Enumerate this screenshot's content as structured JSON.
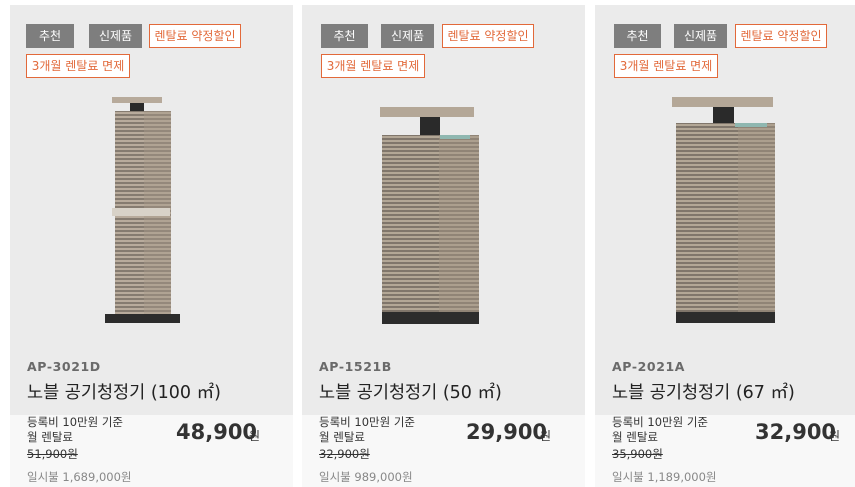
{
  "products": [
    {
      "badges": [
        "추천",
        "신제품",
        "렌탈료 약정할인",
        "3개월 렌탈료 면제"
      ],
      "model": "AP-3021D",
      "name": "노블 공기청정기 (100 ㎡)",
      "registration_line1": "등록비 10만원 기준",
      "registration_line2": "월 렌탈료",
      "original_price": "51,900원",
      "price": "48,900",
      "price_unit": "원",
      "lump_sum": "일시불 1,689,000원"
    },
    {
      "badges": [
        "추천",
        "신제품",
        "렌탈료 약정할인",
        "3개월 렌탈료 면제"
      ],
      "model": "AP-1521B",
      "name": "노블 공기청정기 (50 ㎡)",
      "registration_line1": "등록비 10만원 기준",
      "registration_line2": "월 렌탈료",
      "original_price": "32,900원",
      "price": "29,900",
      "price_unit": "원",
      "lump_sum": "일시불 989,000원"
    },
    {
      "badges": [
        "추천",
        "신제품",
        "렌탈료 약정할인",
        "3개월 렌탈료 면제"
      ],
      "model": "AP-2021A",
      "name": "노블 공기청정기 (67 ㎡)",
      "registration_line1": "등록비 10만원 기준",
      "registration_line2": "월 렌탈료",
      "original_price": "35,900원",
      "price": "32,900",
      "price_unit": "원",
      "lump_sum": "일시불 1,189,000원"
    }
  ],
  "colors": {
    "badge_gray": "#7e7e7e",
    "badge_orange": "#e2693a",
    "card_background": "#ebebeb"
  },
  "icons": {
    "product_image": "air-purifier-tower"
  }
}
